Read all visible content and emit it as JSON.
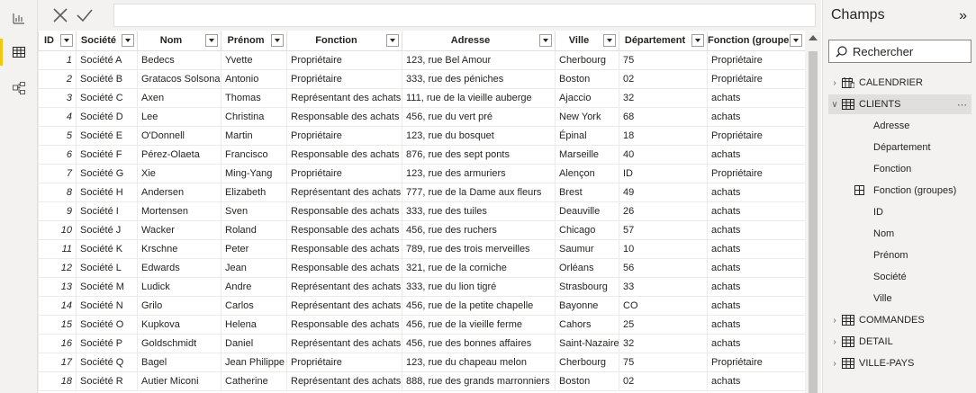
{
  "rail": {
    "icons": [
      "report-view-icon",
      "data-view-icon",
      "model-view-icon"
    ],
    "active": 1
  },
  "grid": {
    "columns": [
      {
        "label": "ID",
        "width": 42
      },
      {
        "label": "Société",
        "width": 68
      },
      {
        "label": "Nom",
        "width": 93
      },
      {
        "label": "Prénom",
        "width": 73
      },
      {
        "label": "Fonction",
        "width": 128
      },
      {
        "label": "Adresse",
        "width": 170
      },
      {
        "label": "Ville",
        "width": 71
      },
      {
        "label": "Département",
        "width": 98
      },
      {
        "label": "Fonction (groupes)",
        "width": 109
      }
    ],
    "rows": [
      [
        "1",
        "Société A",
        "Bedecs",
        "Yvette",
        "Propriétaire",
        "123, rue Bel Amour",
        "Cherbourg",
        "75",
        "Propriétaire"
      ],
      [
        "2",
        "Société B",
        "Gratacos Solsona",
        "Antonio",
        "Propriétaire",
        "333, rue des péniches",
        "Boston",
        "02",
        "Propriétaire"
      ],
      [
        "3",
        "Société C",
        "Axen",
        "Thomas",
        "Représentant des achats",
        "111, rue de la vieille auberge",
        "Ajaccio",
        "32",
        "achats"
      ],
      [
        "4",
        "Société D",
        "Lee",
        "Christina",
        "Responsable des achats",
        "456, rue du vert pré",
        "New York",
        "68",
        "achats"
      ],
      [
        "5",
        "Société E",
        "O'Donnell",
        "Martin",
        "Propriétaire",
        "123, rue du bosquet",
        "Épinal",
        "18",
        "Propriétaire"
      ],
      [
        "6",
        "Société F",
        "Pérez-Olaeta",
        "Francisco",
        "Responsable des achats",
        "876, rue des sept ponts",
        "Marseille",
        "40",
        "achats"
      ],
      [
        "7",
        "Société G",
        "Xie",
        "Ming-Yang",
        "Propriétaire",
        "123, rue des armuriers",
        "Alençon",
        "ID",
        "Propriétaire"
      ],
      [
        "8",
        "Société H",
        "Andersen",
        "Elizabeth",
        "Représentant des achats",
        "777, rue de la Dame aux fleurs",
        "Brest",
        "49",
        "achats"
      ],
      [
        "9",
        "Société I",
        "Mortensen",
        "Sven",
        "Responsable des achats",
        "333, rue des tuiles",
        "Deauville",
        "26",
        "achats"
      ],
      [
        "10",
        "Société J",
        "Wacker",
        "Roland",
        "Responsable des achats",
        "456, rue des ruchers",
        "Chicago",
        "57",
        "achats"
      ],
      [
        "11",
        "Société K",
        "Krschne",
        "Peter",
        "Responsable des achats",
        "789, rue des trois merveilles",
        "Saumur",
        "10",
        "achats"
      ],
      [
        "12",
        "Société L",
        "Edwards",
        "Jean",
        "Responsable des achats",
        "321, rue de la corniche",
        "Orléans",
        "56",
        "achats"
      ],
      [
        "13",
        "Société M",
        "Ludick",
        "Andre",
        "Représentant des achats",
        "333, rue du lion tigré",
        "Strasbourg",
        "33",
        "achats"
      ],
      [
        "14",
        "Société N",
        "Grilo",
        "Carlos",
        "Représentant des achats",
        "456, rue de la petite chapelle",
        "Bayonne",
        "CO",
        "achats"
      ],
      [
        "15",
        "Société O",
        "Kupkova",
        "Helena",
        "Responsable des achats",
        "456, rue de la vieille ferme",
        "Cahors",
        "25",
        "achats"
      ],
      [
        "16",
        "Société P",
        "Goldschmidt",
        "Daniel",
        "Représentant des achats",
        "456, rue des bonnes affaires",
        "Saint-Nazaire",
        "32",
        "achats"
      ],
      [
        "17",
        "Société Q",
        "Bagel",
        "Jean Philippe",
        "Propriétaire",
        "123, rue du chapeau melon",
        "Cherbourg",
        "75",
        "Propriétaire"
      ],
      [
        "18",
        "Société R",
        "Autier Miconi",
        "Catherine",
        "Représentant des achats",
        "888, rue des grands marronniers",
        "Boston",
        "02",
        "achats"
      ]
    ]
  },
  "pane": {
    "title": "Champs",
    "collapse_glyph": "»",
    "search_placeholder": "Rechercher",
    "tables": [
      {
        "name": "CALENDRIER",
        "expanded": false
      },
      {
        "name": "CLIENTS",
        "expanded": true
      },
      {
        "name": "COMMANDES",
        "expanded": false
      },
      {
        "name": "DETAIL",
        "expanded": false
      },
      {
        "name": "VILLE-PAYS",
        "expanded": false
      }
    ],
    "clients_fields": [
      "Adresse",
      "Département",
      "Fonction",
      "Fonction (groupes)",
      "ID",
      "Nom",
      "Prénom",
      "Société",
      "Ville"
    ],
    "row_actions": "⋯"
  }
}
